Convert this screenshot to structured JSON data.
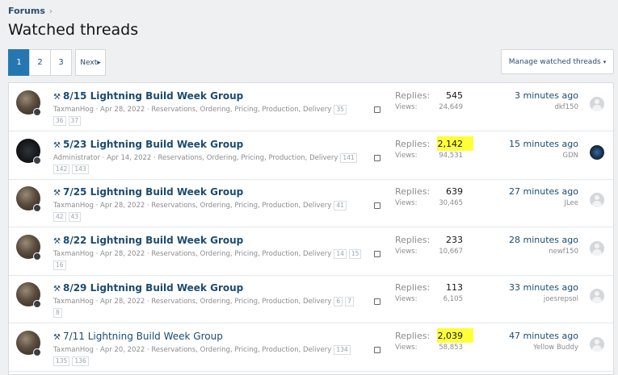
{
  "breadcrumb": {
    "forums": "Forums",
    "sep": "›"
  },
  "page": {
    "title": "Watched threads"
  },
  "pagination": {
    "pages": [
      "1",
      "2",
      "3"
    ],
    "current": "1",
    "next": "Next",
    "next_arrow": "▸"
  },
  "manage_button": {
    "label": "Manage watched threads",
    "caret": "▾"
  },
  "labels": {
    "replies": "Replies:",
    "views": "Views:"
  },
  "colors": {
    "accent": "#2577b1",
    "link": "#1c4b71",
    "highlight": "#ffff3a"
  },
  "threads": [
    {
      "icon": "wrench-icon",
      "wrench": "⚒",
      "title": "8/15 Lightning Build Week Group",
      "bold": true,
      "author": "TaxmanHog",
      "date": "Apr 28, 2022",
      "forum": "Reservations, Ordering, Pricing, Production, Delivery",
      "pages_inline": [
        "35"
      ],
      "pages_wrap": [
        "36",
        "37"
      ],
      "replies": "545",
      "views": "24,649",
      "replies_highlighted": false,
      "latest_time": "3 minutes ago",
      "latest_user": "dkf150",
      "avatar": "photo"
    },
    {
      "icon": "wrench-icon",
      "wrench": "⚒",
      "title": "5/23 Lightning Build Week Group",
      "bold": true,
      "author": "Administrator",
      "date": "Apr 14, 2022",
      "forum": "Reservations, Ordering, Pricing, Production, Delivery",
      "pages_inline": [
        "141"
      ],
      "pages_wrap": [
        "142",
        "143"
      ],
      "replies": "2,142",
      "views": "94,531",
      "replies_highlighted": true,
      "latest_time": "15 minutes ago",
      "latest_user": "GDN",
      "avatar": "dark"
    },
    {
      "icon": "wrench-icon",
      "wrench": "⚒",
      "title": "7/25 Lightning Build Week Group",
      "bold": true,
      "author": "TaxmanHog",
      "date": "Apr 28, 2022",
      "forum": "Reservations, Ordering, Pricing, Production, Delivery",
      "pages_inline": [
        "41"
      ],
      "pages_wrap": [
        "42",
        "43"
      ],
      "replies": "639",
      "views": "30,465",
      "replies_highlighted": false,
      "latest_time": "27 minutes ago",
      "latest_user": "JLee",
      "avatar": "photo"
    },
    {
      "icon": "wrench-icon",
      "wrench": "⚒",
      "title": "8/22 Lightning Build Week Group",
      "bold": true,
      "author": "TaxmanHog",
      "date": "Apr 28, 2022",
      "forum": "Reservations, Ordering, Pricing, Production, Delivery",
      "pages_inline": [
        "14",
        "15"
      ],
      "pages_wrap": [
        "16"
      ],
      "replies": "233",
      "views": "10,667",
      "replies_highlighted": false,
      "latest_time": "28 minutes ago",
      "latest_user": "newf150",
      "avatar": "photo"
    },
    {
      "icon": "wrench-icon",
      "wrench": "⚒",
      "title": "8/29 Lightning Build Week Group",
      "bold": true,
      "author": "TaxmanHog",
      "date": "Apr 28, 2022",
      "forum": "Reservations, Ordering, Pricing, Production, Delivery",
      "pages_inline": [
        "6",
        "7"
      ],
      "pages_wrap": [
        "8"
      ],
      "replies": "113",
      "views": "6,105",
      "replies_highlighted": false,
      "latest_time": "33 minutes ago",
      "latest_user": "joesrepsol",
      "avatar": "photo"
    },
    {
      "icon": "wrench-icon",
      "wrench": "⚒",
      "title": "7/11 Lightning Build Week Group",
      "bold": false,
      "author": "TaxmanHog",
      "date": "Apr 20, 2022",
      "forum": "Reservations, Ordering, Pricing, Production, Delivery",
      "pages_inline": [
        "134"
      ],
      "pages_wrap": [
        "135",
        "136"
      ],
      "replies": "2,039",
      "views": "58,853",
      "replies_highlighted": true,
      "latest_time": "47 minutes ago",
      "latest_user": "Yellow Buddy",
      "avatar": "photo"
    }
  ]
}
